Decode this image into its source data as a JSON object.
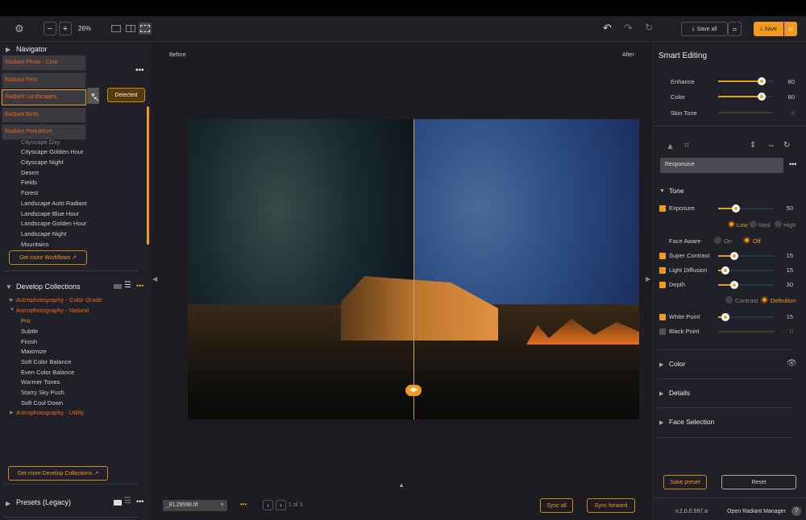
{
  "toolbar": {
    "zoom": "26%",
    "save_all": "Save all",
    "save": "Save"
  },
  "navigator": {
    "title": "Navigator",
    "detected": "Detected",
    "dropdown": [
      "Radiant Photo - Core",
      "Radiant Pets",
      "Radiant Landscapes",
      "Radiant Birds",
      "Radiant Portraiture"
    ],
    "selected": "Radiant Landscapes",
    "workflows": [
      "Cityscape Day",
      "Cityscape Golden Hour",
      "Cityscape Night",
      "Desert",
      "Fields",
      "Forest",
      "Landscape Auto Radiant",
      "Landscape Blue Hour",
      "Landscape Golden Hour",
      "Landscape Night",
      "Mountains"
    ],
    "get_more": "Get more Workflows"
  },
  "develop": {
    "title": "Develop Collections",
    "collections": [
      {
        "name": "Astrophotography - Color Grade",
        "expanded": false
      },
      {
        "name": "Astrophotography - Natural",
        "expanded": true,
        "items": [
          "Pro",
          "Subtle",
          "Finish",
          "Maximize",
          "Soft Color Balance",
          "Even Color Balance",
          "Warmer Tones",
          "Starry Sky Push",
          "Soft Cool Down"
        ],
        "selected": "Pro"
      },
      {
        "name": "Astrophotography - Utility",
        "expanded": false
      }
    ],
    "get_more": "Get more Develop Collections"
  },
  "presets": {
    "title": "Presets (Legacy)"
  },
  "viewer": {
    "before": "Before",
    "after": "After",
    "filename": "_EL29598.tif",
    "page": "1 of 3",
    "sync_all": "Sync all",
    "sync_forward": "Sync forward"
  },
  "smart": {
    "title": "Smart Editing",
    "sliders": [
      {
        "label": "Enhance",
        "value": 80
      },
      {
        "label": "Color",
        "value": 80
      },
      {
        "label": "Skin Tone",
        "value": 0
      }
    ]
  },
  "profile": "Responsive",
  "tone": {
    "title": "Tone",
    "exposure": {
      "label": "Exposure",
      "value": 50,
      "checked": true
    },
    "exposure_modes": [
      "Low",
      "Med",
      "High"
    ],
    "exposure_mode": "Low",
    "face_aware": {
      "label": "Face Aware",
      "options": [
        "On",
        "Off"
      ],
      "selected": "Off"
    },
    "super_contrast": {
      "label": "Super Contrast",
      "value": 15,
      "checked": true
    },
    "light_diffusion": {
      "label": "Light Diffusion",
      "value": 15,
      "checked": true
    },
    "depth": {
      "label": "Depth",
      "value": 30,
      "checked": true
    },
    "depth_modes": [
      "Contrast",
      "Definition"
    ],
    "depth_mode": "Definition",
    "white_point": {
      "label": "White Point",
      "value": 15,
      "checked": true
    },
    "black_point": {
      "label": "Black Point",
      "value": 0,
      "checked": false
    }
  },
  "sections": [
    "Color",
    "Details",
    "Face Selection"
  ],
  "footer": {
    "save_preset": "Save preset",
    "reset": "Reset",
    "version": "v.2.0.0.597.a",
    "open_manager": "Open Radiant Manager"
  },
  "colors": {
    "accent": "#f29a1b",
    "orange_text": "#f0681e"
  }
}
